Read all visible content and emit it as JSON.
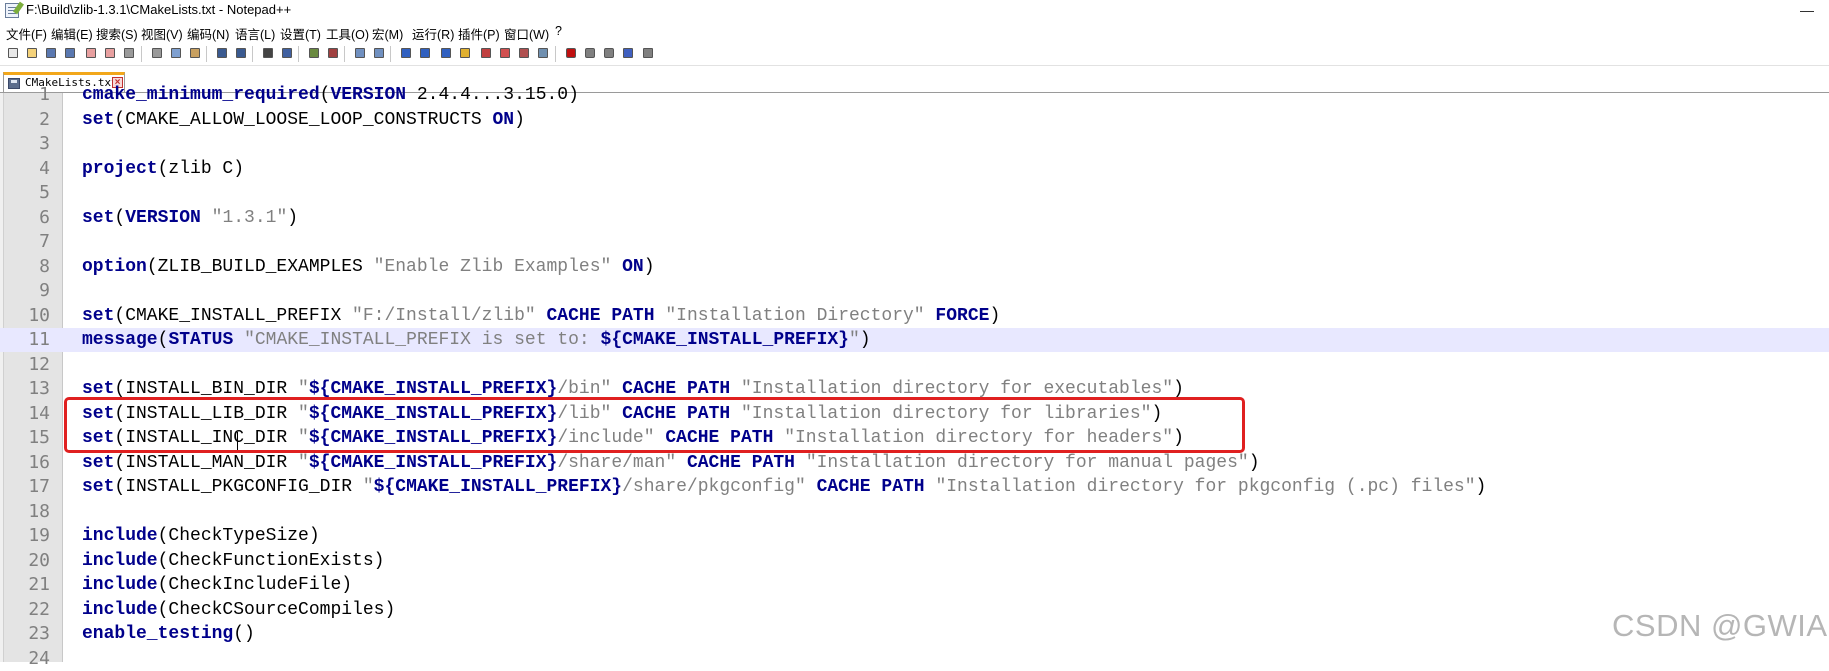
{
  "window": {
    "title": "F:\\Build\\zlib-1.3.1\\CMakeLists.txt - Notepad++",
    "minimize_glyph": "—"
  },
  "menu": [
    "文件(F)",
    "编辑(E)",
    "搜索(S)",
    "视图(V)",
    "编码(N)",
    "语言(L)",
    "设置(T)",
    "工具(O)",
    "宏(M)",
    "运行(R)",
    "插件(P)",
    "窗口(W)",
    "?"
  ],
  "toolbar": {
    "icons": [
      "new-file-icon",
      "open-file-icon",
      "save-icon",
      "save-all-icon",
      "close-icon",
      "close-all-icon",
      "print-icon",
      "cut-icon",
      "copy-icon",
      "paste-icon",
      "undo-icon",
      "redo-icon",
      "find-icon",
      "replace-icon",
      "zoom-in-icon",
      "zoom-out-icon",
      "sync-vertical-icon",
      "sync-horizontal-icon",
      "word-wrap-icon",
      "show-all-characters-icon",
      "indent-guide-icon",
      "language-icon",
      "document-map-icon",
      "function-list-icon",
      "folder-workspace-icon",
      "monitoring-icon",
      "record-macro-icon",
      "stop-record-icon",
      "play-macro-icon",
      "run-macro-multiple-icon",
      "save-macro-icon"
    ]
  },
  "tab": {
    "label": "CMakeLists.txt",
    "close_glyph": "×"
  },
  "editor": {
    "current_line": 11,
    "lines": [
      {
        "n": "1",
        "t": [
          [
            "kw",
            "cmake_minimum_required"
          ],
          [
            "p",
            "("
          ],
          [
            "kw",
            "VERSION"
          ],
          [
            "p",
            " 2.4.4...3.15.0)"
          ]
        ]
      },
      {
        "n": "2",
        "t": [
          [
            "kw",
            "set"
          ],
          [
            "p",
            "(CMAKE_ALLOW_LOOSE_LOOP_CONSTRUCTS "
          ],
          [
            "kw",
            "ON"
          ],
          [
            "p",
            ")"
          ]
        ]
      },
      {
        "n": "3",
        "t": []
      },
      {
        "n": "4",
        "t": [
          [
            "kw",
            "project"
          ],
          [
            "p",
            "(zlib C)"
          ]
        ]
      },
      {
        "n": "5",
        "t": []
      },
      {
        "n": "6",
        "t": [
          [
            "kw",
            "set"
          ],
          [
            "p",
            "("
          ],
          [
            "kw",
            "VERSION"
          ],
          [
            "p",
            " "
          ],
          [
            "s",
            "\"1.3.1\""
          ],
          [
            "p",
            ")"
          ]
        ]
      },
      {
        "n": "7",
        "t": []
      },
      {
        "n": "8",
        "t": [
          [
            "kw",
            "option"
          ],
          [
            "p",
            "(ZLIB_BUILD_EXAMPLES "
          ],
          [
            "s",
            "\"Enable Zlib Examples\""
          ],
          [
            "p",
            " "
          ],
          [
            "kw",
            "ON"
          ],
          [
            "p",
            ")"
          ]
        ]
      },
      {
        "n": "9",
        "t": []
      },
      {
        "n": "10",
        "t": [
          [
            "kw",
            "set"
          ],
          [
            "p",
            "(CMAKE_INSTALL_PREFIX "
          ],
          [
            "s",
            "\"F:/Install/zlib\""
          ],
          [
            "p",
            " "
          ],
          [
            "kw",
            "CACHE"
          ],
          [
            "p",
            " "
          ],
          [
            "kw",
            "PATH"
          ],
          [
            "p",
            " "
          ],
          [
            "s",
            "\"Installation Directory\""
          ],
          [
            "p",
            " "
          ],
          [
            "kw",
            "FORCE"
          ],
          [
            "p",
            ")"
          ]
        ]
      },
      {
        "n": "11",
        "t": [
          [
            "kw",
            "message"
          ],
          [
            "p",
            "("
          ],
          [
            "kw",
            "STATUS"
          ],
          [
            "p",
            " "
          ],
          [
            "s",
            "\"CMAKE_INSTALL_PREFIX is set to: "
          ],
          [
            "sb",
            "${CMAKE_INSTALL_PREFIX}"
          ],
          [
            "s",
            "\""
          ],
          [
            "p",
            ")"
          ]
        ]
      },
      {
        "n": "12",
        "t": []
      },
      {
        "n": "13",
        "t": [
          [
            "kw",
            "set"
          ],
          [
            "p",
            "(INSTALL_BIN_DIR "
          ],
          [
            "s",
            "\""
          ],
          [
            "sb",
            "${CMAKE_INSTALL_PREFIX}"
          ],
          [
            "s",
            "/bin\""
          ],
          [
            "p",
            " "
          ],
          [
            "kw",
            "CACHE"
          ],
          [
            "p",
            " "
          ],
          [
            "kw",
            "PATH"
          ],
          [
            "p",
            " "
          ],
          [
            "s",
            "\"Installation directory for executables\""
          ],
          [
            "p",
            ")"
          ]
        ]
      },
      {
        "n": "14",
        "t": [
          [
            "kw",
            "set"
          ],
          [
            "p",
            "(INSTALL_LIB_DIR "
          ],
          [
            "s",
            "\""
          ],
          [
            "sb",
            "${CMAKE_INSTALL_PREFIX}"
          ],
          [
            "s",
            "/lib\""
          ],
          [
            "p",
            " "
          ],
          [
            "kw",
            "CACHE"
          ],
          [
            "p",
            " "
          ],
          [
            "kw",
            "PATH"
          ],
          [
            "p",
            " "
          ],
          [
            "s",
            "\"Installation directory for libraries\""
          ],
          [
            "p",
            ")"
          ]
        ]
      },
      {
        "n": "15",
        "t": [
          [
            "kw",
            "set"
          ],
          [
            "p",
            "(INSTALL_INC_DIR "
          ],
          [
            "s",
            "\""
          ],
          [
            "sb",
            "${CMAKE_INSTALL_PREFIX}"
          ],
          [
            "s",
            "/include\""
          ],
          [
            "p",
            " "
          ],
          [
            "kw",
            "CACHE"
          ],
          [
            "p",
            " "
          ],
          [
            "kw",
            "PATH"
          ],
          [
            "p",
            " "
          ],
          [
            "s",
            "\"Installation directory for headers\""
          ],
          [
            "p",
            ")"
          ]
        ]
      },
      {
        "n": "16",
        "t": [
          [
            "kw",
            "set"
          ],
          [
            "p",
            "(INSTALL_MAN_DIR "
          ],
          [
            "s",
            "\""
          ],
          [
            "sb",
            "${CMAKE_INSTALL_PREFIX}"
          ],
          [
            "s",
            "/share/man\""
          ],
          [
            "p",
            " "
          ],
          [
            "kw",
            "CACHE"
          ],
          [
            "p",
            " "
          ],
          [
            "kw",
            "PATH"
          ],
          [
            "p",
            " "
          ],
          [
            "s",
            "\"Installation directory for manual pages\""
          ],
          [
            "p",
            ")"
          ]
        ]
      },
      {
        "n": "17",
        "t": [
          [
            "kw",
            "set"
          ],
          [
            "p",
            "(INSTALL_PKGCONFIG_DIR "
          ],
          [
            "s",
            "\""
          ],
          [
            "sb",
            "${CMAKE_INSTALL_PREFIX}"
          ],
          [
            "s",
            "/share/pkgconfig\""
          ],
          [
            "p",
            " "
          ],
          [
            "kw",
            "CACHE"
          ],
          [
            "p",
            " "
          ],
          [
            "kw",
            "PATH"
          ],
          [
            "p",
            " "
          ],
          [
            "s",
            "\"Installation directory for pkgconfig (.pc) files\""
          ],
          [
            "p",
            ")"
          ]
        ]
      },
      {
        "n": "18",
        "t": []
      },
      {
        "n": "19",
        "t": [
          [
            "kw",
            "include"
          ],
          [
            "p",
            "(CheckTypeSize)"
          ]
        ]
      },
      {
        "n": "20",
        "t": [
          [
            "kw",
            "include"
          ],
          [
            "p",
            "(CheckFunctionExists)"
          ]
        ]
      },
      {
        "n": "21",
        "t": [
          [
            "kw",
            "include"
          ],
          [
            "p",
            "(CheckIncludeFile)"
          ]
        ]
      },
      {
        "n": "22",
        "t": [
          [
            "kw",
            "include"
          ],
          [
            "p",
            "(CheckCSourceCompiles)"
          ]
        ]
      },
      {
        "n": "23",
        "t": [
          [
            "kw",
            "enable_testing"
          ],
          [
            "p",
            "()"
          ]
        ]
      },
      {
        "n": "24",
        "t": []
      }
    ]
  },
  "watermark": "CSDN @GWIA"
}
